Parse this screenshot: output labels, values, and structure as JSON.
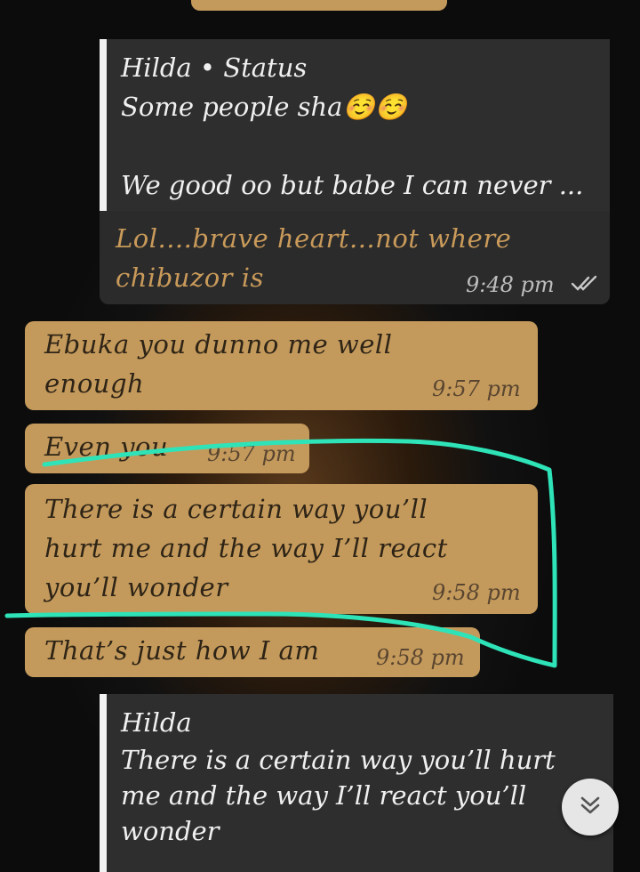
{
  "messages": {
    "reply1": {
      "quote_author": "Hilda • Status",
      "quote_text": "Some people sha☺️☺️\n\nWe good oo but babe I can never ...",
      "text": "Lol....brave heart...not where\nchibuzor is",
      "time": "9:48 pm"
    },
    "in1": {
      "text": "Ebuka you dunno me well\nenough",
      "time": "9:57 pm"
    },
    "in2": {
      "text": "Even you",
      "time": "9:57 pm"
    },
    "in3": {
      "text": "There is a certain way you’ll\nhurt me and the way I’ll react\nyou’ll wonder",
      "time": "9:58 pm"
    },
    "in4": {
      "text": "That’s just how I am",
      "time": "9:58 pm"
    },
    "reply2": {
      "quote_author": "Hilda",
      "quote_text": "There is a certain way you’ll hurt\nme and the way I’ll react you’ll\nwonder"
    }
  },
  "colors": {
    "incoming_bubble": "#c49a5c",
    "outgoing_bubble": "#2b2b2b",
    "annotation_stroke": "#2ee3b7"
  },
  "icons": {
    "read_ticks": "double-check-icon",
    "scroll_down": "chevron-down-icon"
  }
}
